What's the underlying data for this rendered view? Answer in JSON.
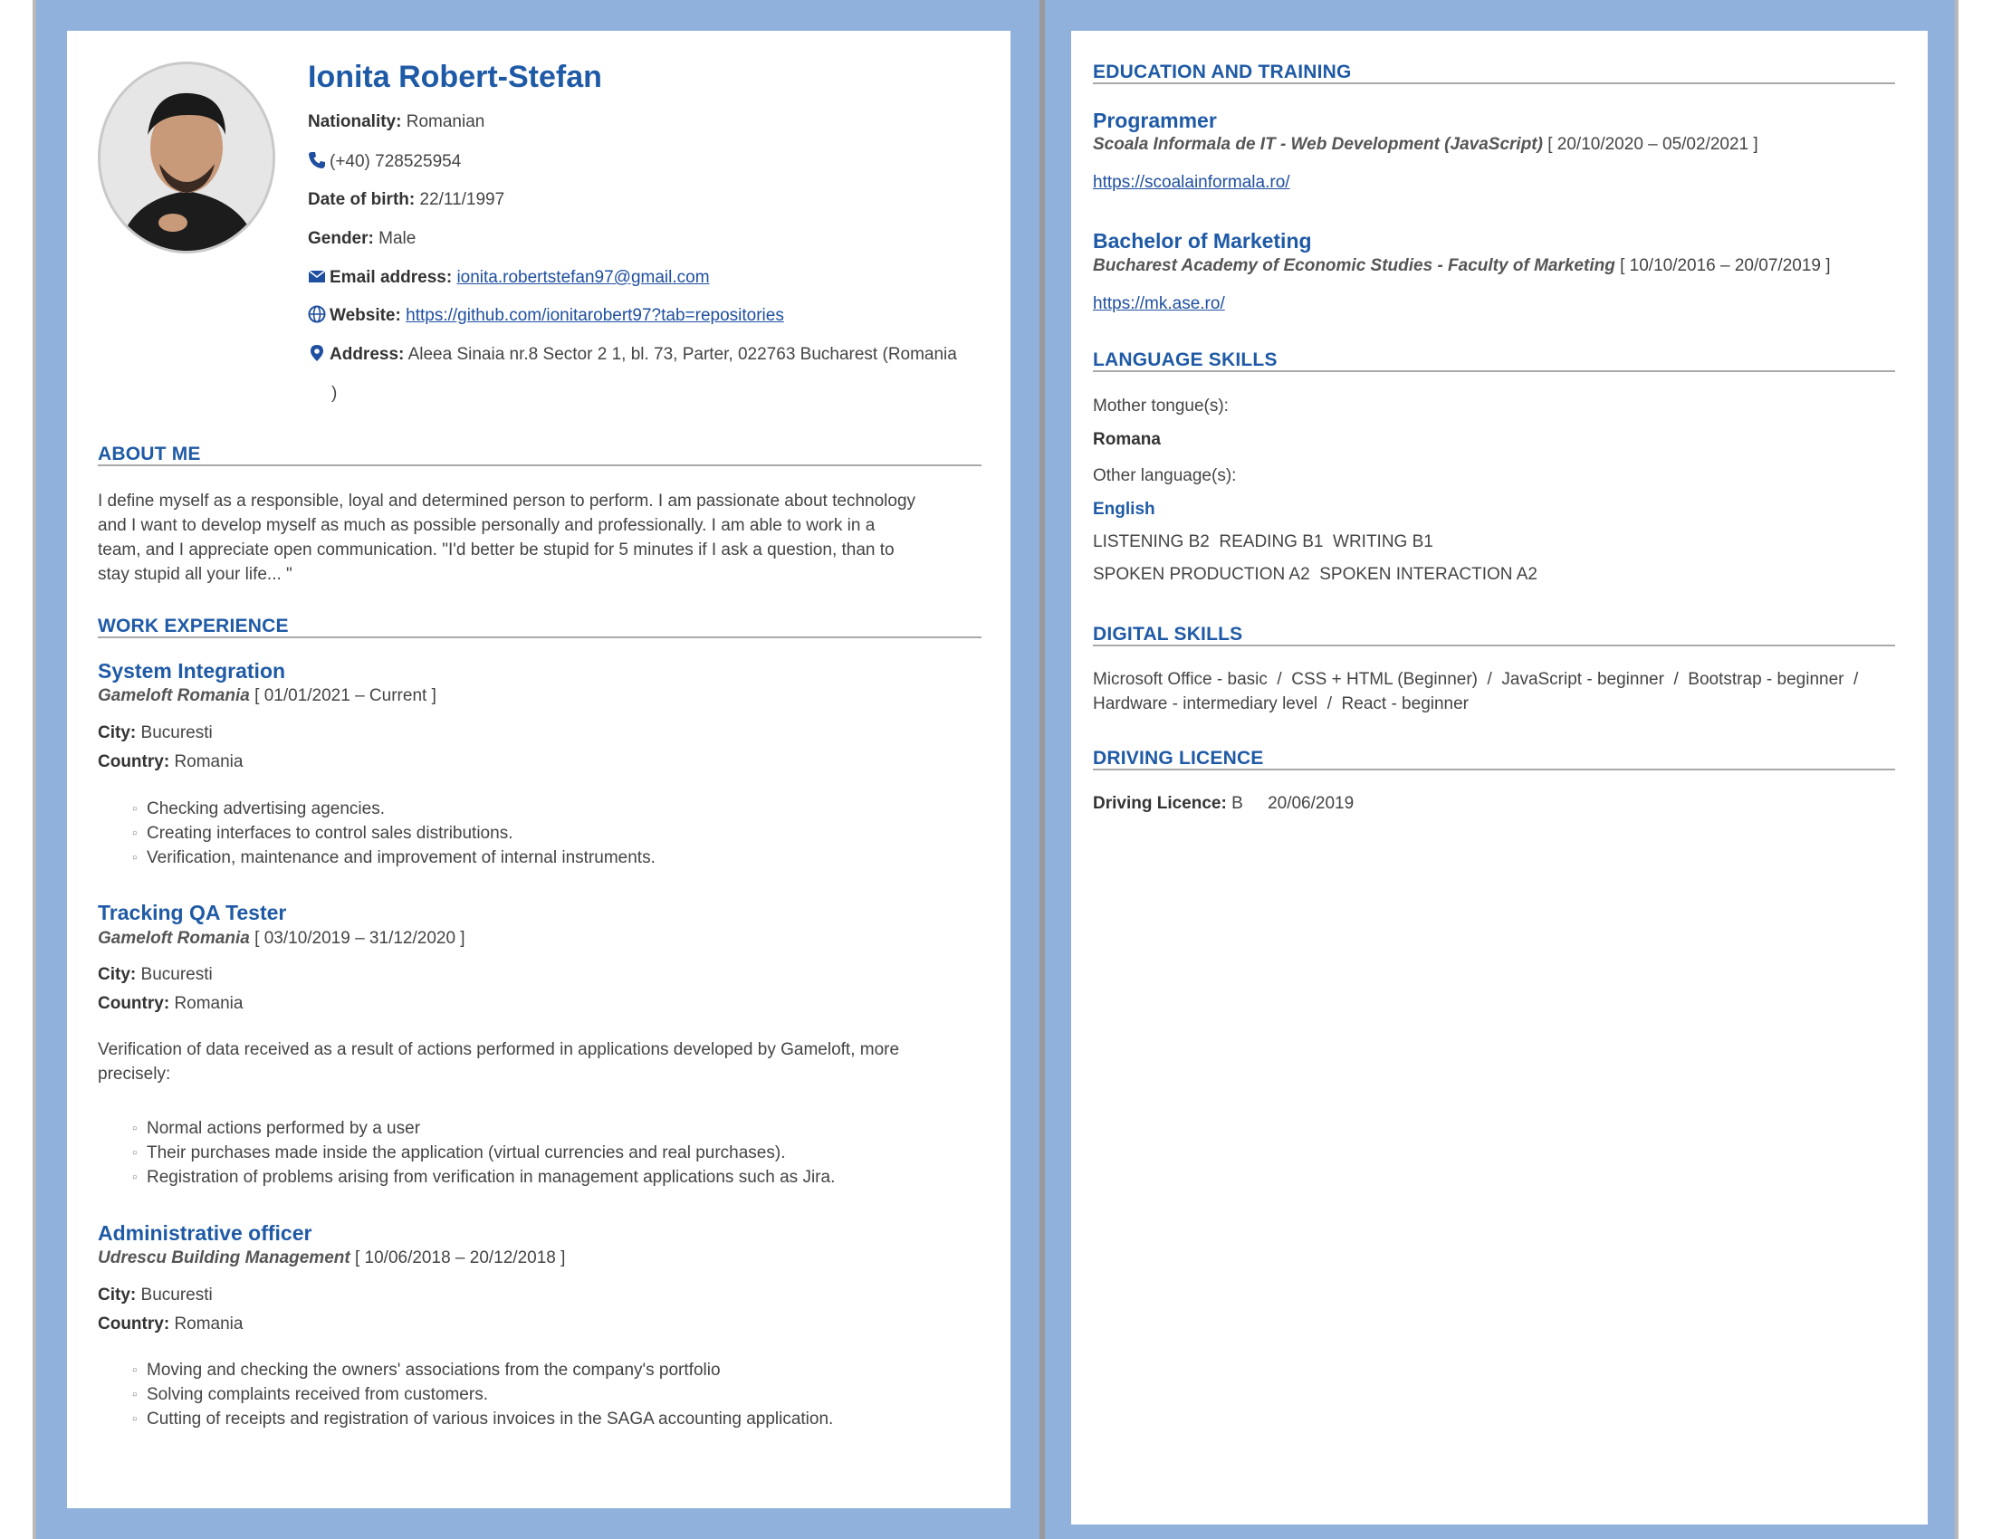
{
  "colors": {
    "accent": "#1f5aa6",
    "frame": "#8fb1dc",
    "rule": "#a9a9a9",
    "text": "#444444"
  },
  "header": {
    "name": "Ionita Robert-Stefan",
    "nationality_label": "Nationality:",
    "nationality": "Romanian",
    "phone": "(+40) 728525954",
    "dob_label": "Date of birth:",
    "dob": "22/11/1997",
    "gender_label": "Gender:",
    "gender": "Male",
    "email_label": "Email address:",
    "email": "ionita.robertstefan97@gmail.com",
    "website_label": "Website:",
    "website": "https://github.com/ionitarobert97?tab=repositories",
    "address_label": "Address:",
    "address": "Aleea Sinaia nr.8 Sector 2 1, bl. 73, Parter, 022763 Bucharest (Romania",
    "address_cont": ")"
  },
  "about": {
    "title": "ABOUT ME",
    "lines": [
      "I define myself as a responsible, loyal and determined person to perform. I am passionate about technology",
      "and I want to develop myself as much as possible personally and professionally. I am able to work in a",
      "team, and I appreciate open communication. \"I'd better be stupid for 5 minutes if I ask a question, than to",
      "stay stupid all your life... \""
    ]
  },
  "work": {
    "title": "WORK EXPERIENCE",
    "city_label": "City:",
    "country_label": "Country:",
    "jobs": [
      {
        "title": "System Integration",
        "company": "Gameloft Romania",
        "dates": "[ 01/01/2021 – Current ]",
        "city": "Bucuresti",
        "country": "Romania",
        "bullets": [
          "Checking advertising agencies.",
          "Creating interfaces to control sales distributions.",
          "Verification, maintenance and improvement of internal instruments."
        ]
      },
      {
        "title": "Tracking QA Tester",
        "company": "Gameloft Romania",
        "dates": "[ 03/10/2019 – 31/12/2020 ]",
        "city": "Bucuresti",
        "country": "Romania",
        "description": [
          "Verification of data received as a result of actions performed in applications developed by Gameloft, more",
          "precisely:"
        ],
        "bullets": [
          "Normal actions performed by a user",
          "Their purchases made inside the application (virtual currencies and real purchases).",
          "Registration of problems arising from verification in management applications such as Jira."
        ]
      },
      {
        "title": "Administrative officer",
        "company": "Udrescu Building Management",
        "dates": "[ 10/06/2018 – 20/12/2018 ]",
        "city": "Bucuresti",
        "country": "Romania",
        "bullets": [
          "Moving and checking the owners' associations from the company's portfolio",
          "Solving complaints received from customers.",
          "Cutting of receipts and registration of various invoices in the SAGA accounting application."
        ]
      }
    ]
  },
  "education": {
    "title": "EDUCATION AND TRAINING",
    "items": [
      {
        "title": "Programmer",
        "institution": "Scoala Informala de IT - Web Development (JavaScript)",
        "dates": "[ 20/10/2020 – 05/02/2021 ]",
        "link": "https://scoalainformala.ro/"
      },
      {
        "title": "Bachelor of Marketing",
        "institution": "Bucharest Academy of Economic Studies - Faculty of Marketing",
        "dates": "[ 10/10/2016 – 20/07/2019 ]",
        "link": "https://mk.ase.ro/"
      }
    ]
  },
  "languages": {
    "title": "LANGUAGE SKILLS",
    "mother_label": "Mother tongue(s):",
    "mother": "Romana",
    "other_label": "Other language(s):",
    "other": "English",
    "levels_line1": "LISTENING B2  READING B1  WRITING B1",
    "levels_line2": "SPOKEN PRODUCTION A2  SPOKEN INTERACTION A2"
  },
  "digital": {
    "title": "DIGITAL SKILLS",
    "line1": "Microsoft Office - basic  /  CSS + HTML (Beginner)  /  JavaScript - beginner  /  Bootstrap - beginner  /",
    "line2": "Hardware - intermediary level  /  React - beginner"
  },
  "driving": {
    "title": "DRIVING LICENCE",
    "label": "Driving Licence:",
    "category": "B",
    "date": "20/06/2019"
  }
}
